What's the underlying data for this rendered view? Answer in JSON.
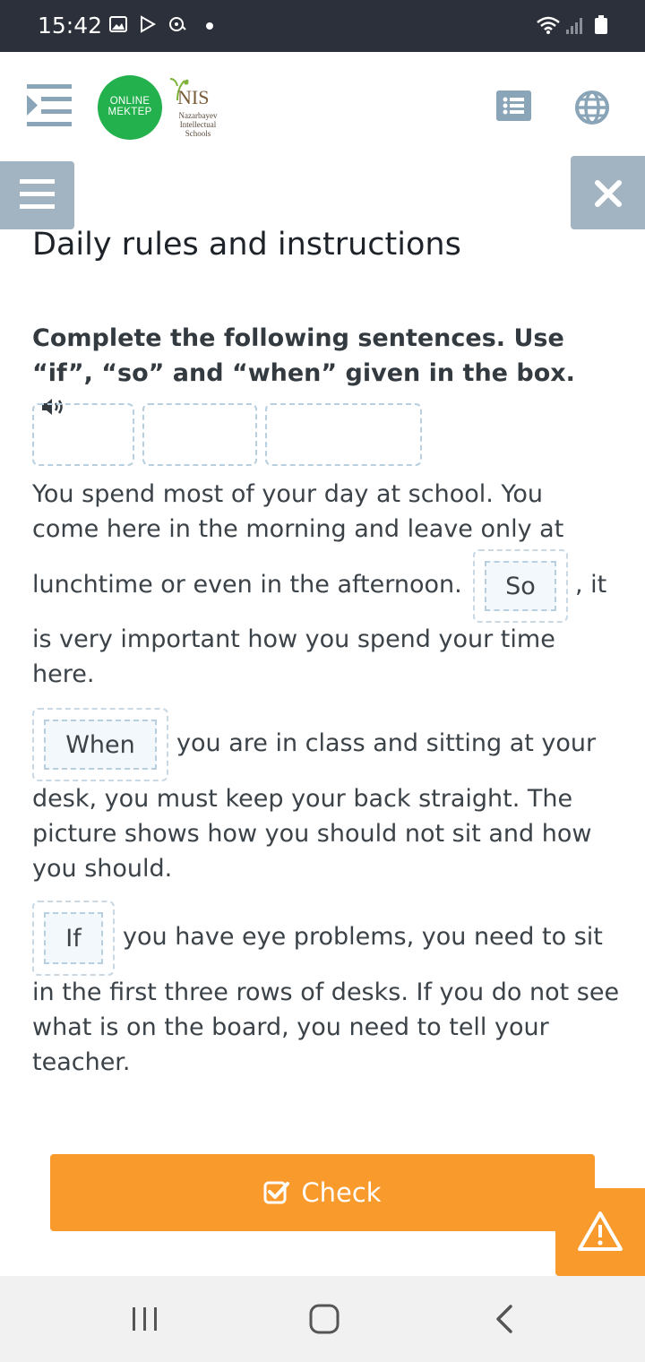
{
  "status_bar": {
    "time": "15:42",
    "icons": [
      "image-icon",
      "play-store-icon",
      "sync-icon",
      "notification-dot",
      "wifi-icon",
      "signal-icon",
      "battery-icon"
    ]
  },
  "header": {
    "logo_online_line1": "ONLINE",
    "logo_online_line2": "MEKTEP",
    "logo_nis": "NIS",
    "logo_nis_sub": "Nazarbayev Intellectual Schools",
    "colors": {
      "logo_green": "#23b14d",
      "nis_brown": "#7a5c3a",
      "icon_gray": "#8aa4b8"
    }
  },
  "page": {
    "title": "Daily rules and instructions",
    "instruction": "Complete the following sentences. Use “if”, “so” and “when” given in the box."
  },
  "exercise": {
    "answers": [
      "So",
      "When",
      "If"
    ],
    "p1": {
      "line1": "You spend most of your day at school. You",
      "line2": "come here in the morning and leave only at",
      "line3_before": "lunchtime or even in the afternoon.",
      "line3_after": ", it",
      "line4": "is very important how you spend your time",
      "line5": "here."
    },
    "p2": {
      "line1_after": "you are in class and sitting at your",
      "line2": "desk, you must keep your back straight. The",
      "line3": "picture shows how you should not sit and how",
      "line4": "you should."
    },
    "p3": {
      "line1_after": "you have eye problems, you need to sit",
      "line2": "in the first three rows of desks. If you do not see",
      "line3": "what is on the board, you need to tell your",
      "line4": "teacher."
    }
  },
  "actions": {
    "check_label": "Check",
    "accent_color": "#f99a2c"
  }
}
